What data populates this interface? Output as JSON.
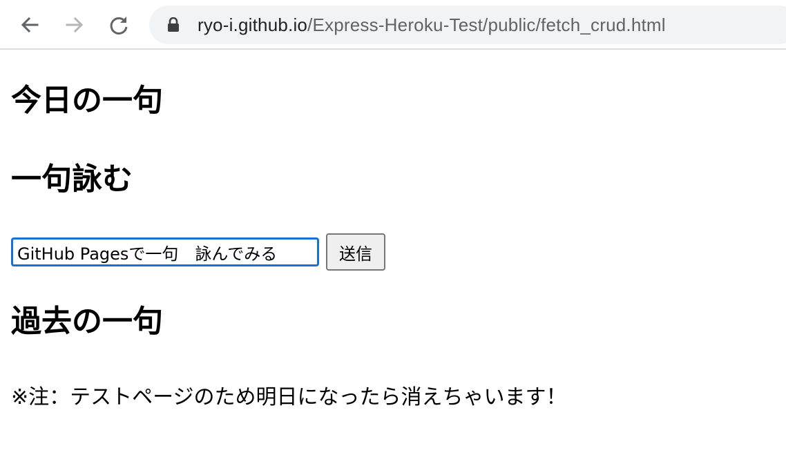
{
  "browser": {
    "back_icon": "arrow-left-icon",
    "forward_icon": "arrow-right-icon",
    "reload_icon": "reload-icon",
    "lock_icon": "lock-icon",
    "url_host": "ryo-i.github.io",
    "url_path": "/Express-Heroku-Test/public/fetch_crud.html"
  },
  "page": {
    "today_heading": "今日の一句",
    "compose_heading": "一句詠む",
    "input_value": "GitHub Pagesで一句　詠んでみる",
    "submit_label": "送信",
    "past_heading": "過去の一句",
    "note_text": "※注：テストページのため明日になったら消えちゃいます！"
  },
  "colors": {
    "input_focus_border": "#1a6fd6",
    "omnibox_bg": "#f1f3f4",
    "button_bg": "#efefef"
  }
}
